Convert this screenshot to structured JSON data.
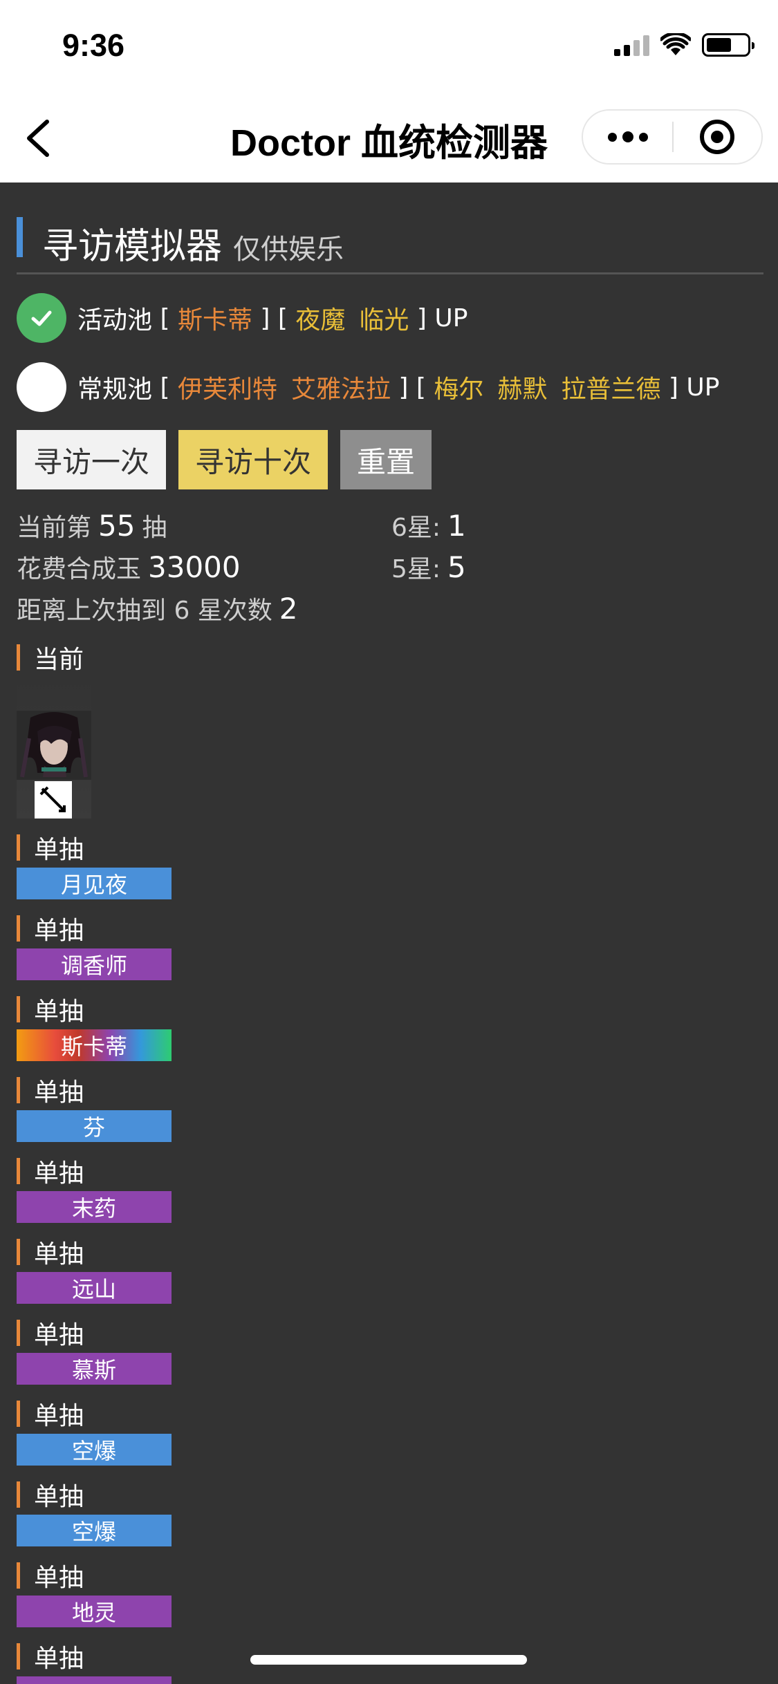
{
  "status_bar": {
    "time": "9:36"
  },
  "nav": {
    "title": "Doctor 血统检测器"
  },
  "header": {
    "title": "寻访模拟器",
    "subtitle": "仅供娱乐"
  },
  "pools": [
    {
      "label": "活动池",
      "selected": true,
      "group1": [
        "斯卡蒂"
      ],
      "group2": [
        "夜魔",
        "临光"
      ],
      "suffix": "UP"
    },
    {
      "label": "常规池",
      "selected": false,
      "group1": [
        "伊芙利特",
        "艾雅法拉"
      ],
      "group2": [
        "梅尔",
        "赫默",
        "拉普兰德"
      ],
      "suffix": "UP"
    }
  ],
  "buttons": {
    "single": "寻访一次",
    "ten": "寻访十次",
    "reset": "重置"
  },
  "stats": {
    "current_prefix": "当前第",
    "current_value": "55",
    "current_suffix": "抽",
    "cost_prefix": "花费合成玉",
    "cost_value": "33000",
    "since_prefix": "距离上次抽到 6 星次数",
    "since_value": "2",
    "six_label": "6星:",
    "six_value": "1",
    "five_label": "5星:",
    "five_value": "5"
  },
  "current_section": "当前",
  "pulls": [
    {
      "label": "单抽",
      "name": "月见夜",
      "color": "blue"
    },
    {
      "label": "单抽",
      "name": "调香师",
      "color": "purple"
    },
    {
      "label": "单抽",
      "name": "斯卡蒂",
      "color": "rainbow"
    },
    {
      "label": "单抽",
      "name": "芬",
      "color": "blue"
    },
    {
      "label": "单抽",
      "name": "末药",
      "color": "purple"
    },
    {
      "label": "单抽",
      "name": "远山",
      "color": "purple"
    },
    {
      "label": "单抽",
      "name": "慕斯",
      "color": "purple"
    },
    {
      "label": "单抽",
      "name": "空爆",
      "color": "blue"
    },
    {
      "label": "单抽",
      "name": "空爆",
      "color": "blue"
    },
    {
      "label": "单抽",
      "name": "地灵",
      "color": "purple"
    },
    {
      "label": "单抽",
      "name": "",
      "color": "purple"
    }
  ],
  "colors": {
    "blue": "#4a90d9",
    "purple": "#8e44ad",
    "orange": "#e8883a",
    "gold": "#e9bf38",
    "check_green": "#4eb565"
  }
}
